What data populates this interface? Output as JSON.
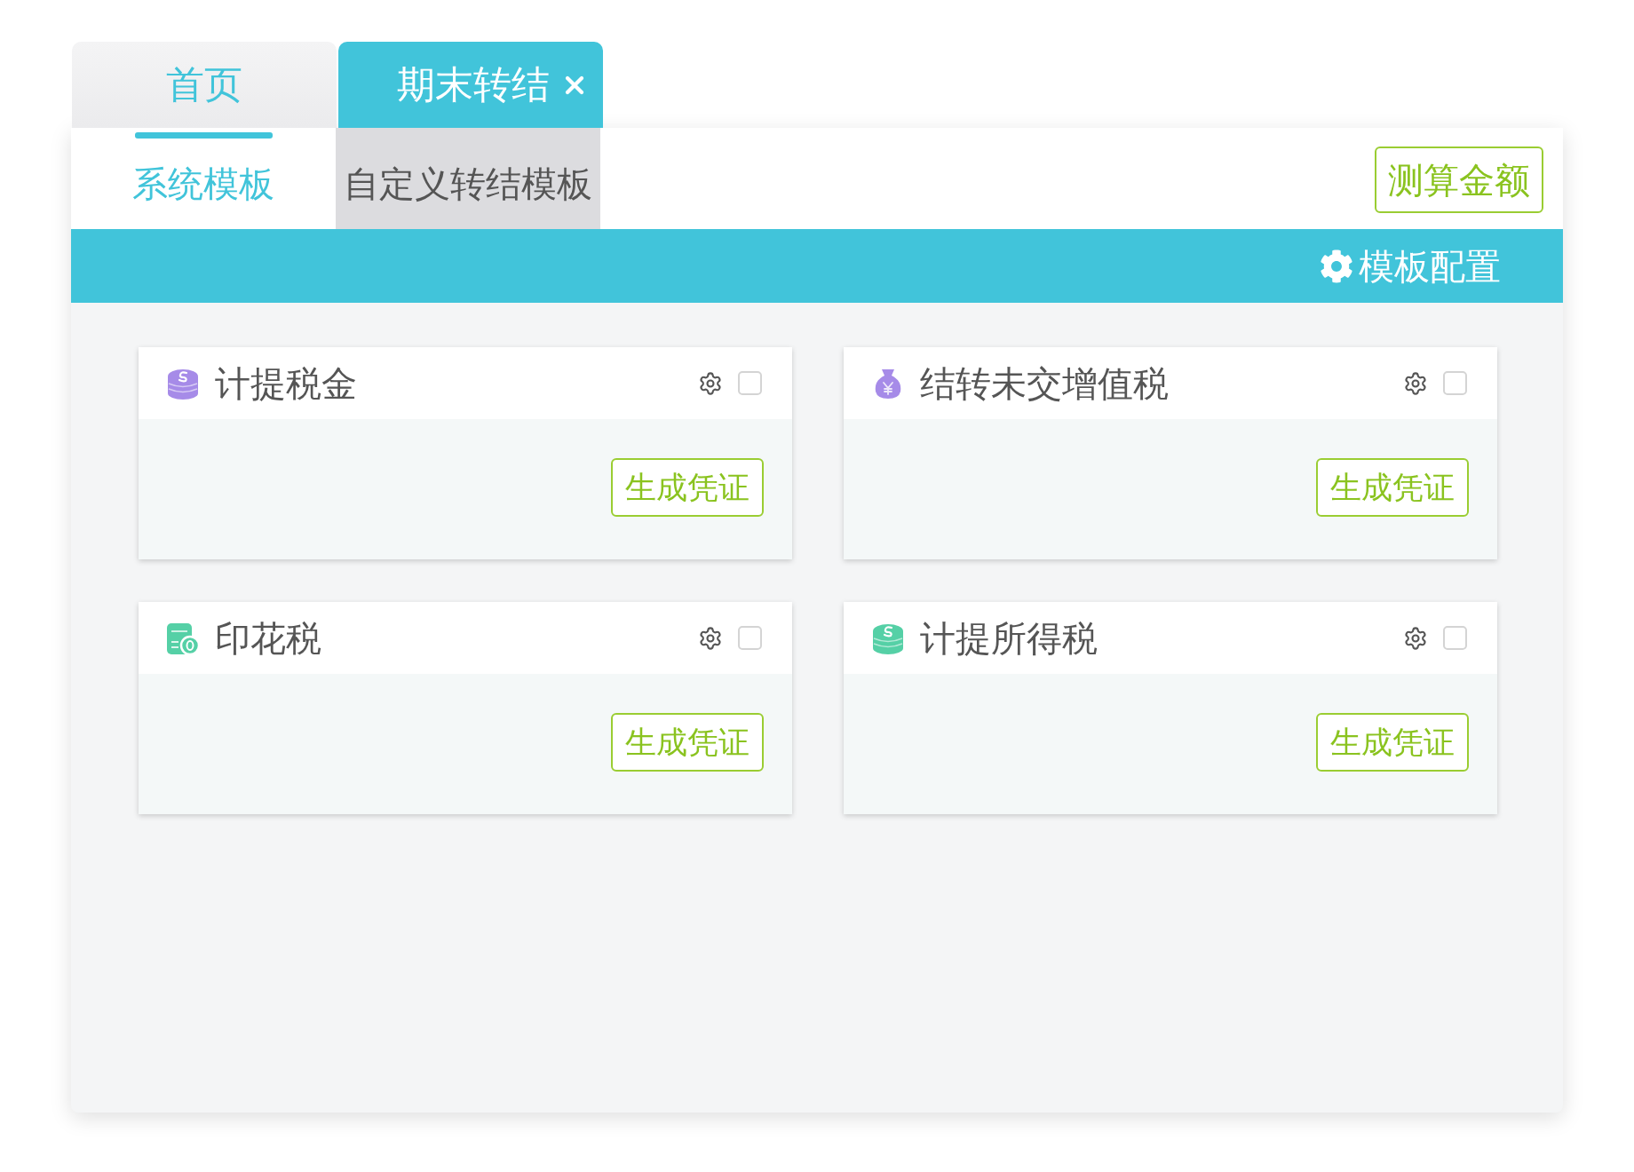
{
  "tabs": [
    {
      "label": "首页",
      "selected": false,
      "closable": false
    },
    {
      "label": "期末转结",
      "selected": true,
      "closable": true
    }
  ],
  "subtabs": [
    {
      "label": "系统模板",
      "selected": true
    },
    {
      "label": "自定义转结模板",
      "selected": false
    }
  ],
  "estimate_button": "测算金额",
  "config_bar": {
    "label": "模板配置"
  },
  "templates": [
    {
      "title": "计提税金",
      "kind": "coins",
      "color": "#a68be8",
      "checked": false,
      "button": "生成凭证"
    },
    {
      "title": "结转未交增值税",
      "kind": "bag",
      "color": "#a68be8",
      "checked": false,
      "button": "生成凭证"
    },
    {
      "title": "印花税",
      "kind": "receipt",
      "color": "#55d0a6",
      "checked": false,
      "button": "生成凭证"
    },
    {
      "title": "计提所得税",
      "kind": "coins",
      "color": "#55d0a6",
      "checked": false,
      "button": "生成凭证"
    }
  ]
}
